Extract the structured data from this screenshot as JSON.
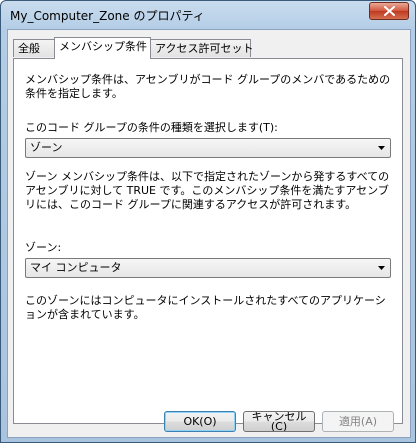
{
  "window": {
    "title": "My_Computer_Zone のプロパティ"
  },
  "tabs": [
    {
      "label": "全般"
    },
    {
      "label": "メンバシップ条件"
    },
    {
      "label": "アクセス許可セット"
    }
  ],
  "panel": {
    "intro": "メンバシップ条件は、アセンブリがコード グループのメンバであるための条件を指定します。",
    "condition_type_label": "このコード グループの条件の種類を選択します(T):",
    "condition_type_value": "ゾーン",
    "zone_description": "ゾーン メンバシップ条件は、以下で指定されたゾーンから発するすべてのアセンブリに対して TRUE です。このメンバシップ条件を満たすアセンブリには、このコード グループに関連するアクセスが許可されます。",
    "zone_label": "ゾーン:",
    "zone_value": "マイ コンピュータ",
    "zone_info": "このゾーンにはコンピュータにインストールされたすべてのアプリケーションが含まれています。"
  },
  "buttons": {
    "ok": "OK(O)",
    "cancel": "キャンセル(C)",
    "apply": "適用(A)"
  },
  "colors": {
    "title_gradient_top": "#c9dcee",
    "close_button": "#d0553d",
    "panel_bg": "#ffffff",
    "client_bg": "#f0f0f0"
  }
}
